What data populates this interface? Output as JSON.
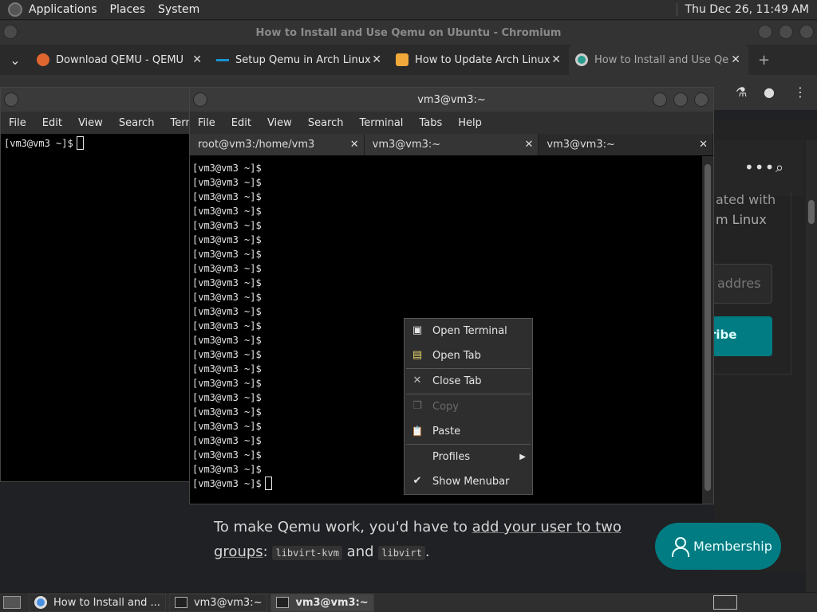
{
  "top_panel": {
    "menus": [
      "Applications",
      "Places",
      "System"
    ],
    "clock": "Thu Dec 26, 11:49 AM"
  },
  "chromium": {
    "title": "How to Install and Use Qemu on Ubuntu - Chromium",
    "tabs": [
      {
        "label": "Download QEMU - QEMU",
        "icon": "qemu-icon",
        "color": "#e0662f"
      },
      {
        "label": "Setup Qemu in Arch Linux",
        "icon": "arch-icon",
        "color": "#1793d1"
      },
      {
        "label": "How to Update Arch Linux",
        "icon": "ubuntu-icon",
        "color": "#f2a93b"
      },
      {
        "label": "How to Install and Use Qe",
        "icon": "site-icon",
        "color": "#2a9d8f"
      }
    ],
    "new_tab": "+",
    "tab_close": "✕",
    "tab_dropdown": "⌄",
    "toolbar_icons": {
      "lab": "⚗",
      "profile": "●",
      "menu": "⋮"
    }
  },
  "web": {
    "dots": "•••",
    "search_glyph": "⌕",
    "text_line1": "ated with",
    "text_line2": "m Linux",
    "email_placeholder": "addres",
    "subscribe_label": "ribe",
    "paragraph": {
      "before": "To make Qemu work, you'd have to ",
      "link": "add your user to two groups",
      "after_link": ": ",
      "code1": "libvirt-kvm",
      "and": " and ",
      "code2": "libvirt",
      "end": "."
    },
    "membership_label": "Membership"
  },
  "termA": {
    "menu": [
      "File",
      "Edit",
      "View",
      "Search",
      "Term"
    ],
    "prompt": "[vm3@vm3 ~]$"
  },
  "termB": {
    "title": "vm3@vm3:~",
    "menu": [
      "File",
      "Edit",
      "View",
      "Search",
      "Terminal",
      "Tabs",
      "Help"
    ],
    "tabs": [
      "root@vm3:/home/vm3",
      "vm3@vm3:~",
      "vm3@vm3:~"
    ],
    "tab_close": "✕",
    "prompt": "[vm3@vm3 ~]$",
    "lines": [
      "[vm3@vm3 ~]$",
      "[vm3@vm3 ~]$",
      "[vm3@vm3 ~]$",
      "[vm3@vm3 ~]$",
      "[vm3@vm3 ~]$",
      "[vm3@vm3 ~]$",
      "[vm3@vm3 ~]$",
      "[vm3@vm3 ~]$",
      "[vm3@vm3 ~]$",
      "[vm3@vm3 ~]$",
      "[vm3@vm3 ~]$",
      "[vm3@vm3 ~]$",
      "[vm3@vm3 ~]$",
      "[vm3@vm3 ~]$",
      "[vm3@vm3 ~]$",
      "[vm3@vm3 ~]$",
      "[vm3@vm3 ~]$",
      "[vm3@vm3 ~]$",
      "[vm3@vm3 ~]$",
      "[vm3@vm3 ~]$",
      "[vm3@vm3 ~]$",
      "[vm3@vm3 ~]$",
      "[vm3@vm3 ~]$"
    ]
  },
  "context_menu": {
    "items": [
      {
        "label": "Open Terminal",
        "icon": "terminal-icon",
        "glyph": "▣"
      },
      {
        "label": "Open Tab",
        "icon": "new-tab-icon",
        "glyph": "▤"
      },
      {
        "label": "Close Tab",
        "icon": "close-icon",
        "glyph": "✕"
      },
      {
        "label": "Copy",
        "icon": "copy-icon",
        "glyph": "❐",
        "disabled": true
      },
      {
        "label": "Paste",
        "icon": "paste-icon",
        "glyph": "📋"
      },
      {
        "label": "Profiles",
        "icon": "",
        "glyph": "",
        "arrow": "▶"
      },
      {
        "label": "Show Menubar",
        "icon": "check-icon",
        "glyph": "✔"
      }
    ]
  },
  "taskbar": {
    "tasks": [
      "How to Install and ...",
      "vm3@vm3:~",
      "vm3@vm3:~"
    ]
  },
  "colors": {
    "teal": "#007c82",
    "terminal_bg": "#000000"
  }
}
